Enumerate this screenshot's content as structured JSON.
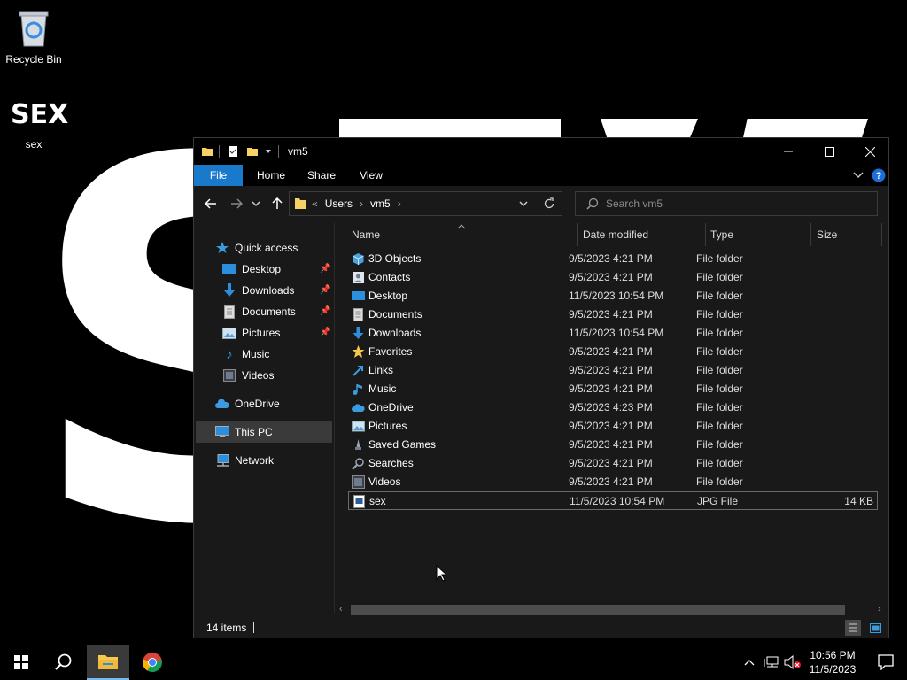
{
  "desktop": {
    "recycle_bin_label": "Recycle Bin",
    "sex_icon_text": "SEX",
    "sex_file_label": "sex",
    "wallpaper_letter": "S"
  },
  "window": {
    "title": "vm5",
    "ribbon_tabs": [
      "File",
      "Home",
      "Share",
      "View"
    ],
    "breadcrumb": [
      "Users",
      "vm5"
    ],
    "search_placeholder": "Search vm5"
  },
  "nav": {
    "quick_access": "Quick access",
    "pinned": [
      "Desktop",
      "Downloads",
      "Documents",
      "Pictures"
    ],
    "unpinned": [
      "Music",
      "Videos"
    ],
    "onedrive": "OneDrive",
    "this_pc": "This PC",
    "network": "Network"
  },
  "columns": {
    "name": "Name",
    "date": "Date modified",
    "type": "Type",
    "size": "Size"
  },
  "files": [
    {
      "name": "3D Objects",
      "date": "9/5/2023 4:21 PM",
      "type": "File folder",
      "size": "",
      "icon": "3d-objects-icon"
    },
    {
      "name": "Contacts",
      "date": "9/5/2023 4:21 PM",
      "type": "File folder",
      "size": "",
      "icon": "contacts-icon"
    },
    {
      "name": "Desktop",
      "date": "11/5/2023 10:54 PM",
      "type": "File folder",
      "size": "",
      "icon": "desktop-icon"
    },
    {
      "name": "Documents",
      "date": "9/5/2023 4:21 PM",
      "type": "File folder",
      "size": "",
      "icon": "documents-icon"
    },
    {
      "name": "Downloads",
      "date": "11/5/2023 10:54 PM",
      "type": "File folder",
      "size": "",
      "icon": "downloads-icon"
    },
    {
      "name": "Favorites",
      "date": "9/5/2023 4:21 PM",
      "type": "File folder",
      "size": "",
      "icon": "favorites-icon"
    },
    {
      "name": "Links",
      "date": "9/5/2023 4:21 PM",
      "type": "File folder",
      "size": "",
      "icon": "links-icon"
    },
    {
      "name": "Music",
      "date": "9/5/2023 4:21 PM",
      "type": "File folder",
      "size": "",
      "icon": "music-icon"
    },
    {
      "name": "OneDrive",
      "date": "9/5/2023 4:23 PM",
      "type": "File folder",
      "size": "",
      "icon": "onedrive-icon"
    },
    {
      "name": "Pictures",
      "date": "9/5/2023 4:21 PM",
      "type": "File folder",
      "size": "",
      "icon": "pictures-icon"
    },
    {
      "name": "Saved Games",
      "date": "9/5/2023 4:21 PM",
      "type": "File folder",
      "size": "",
      "icon": "saved-games-icon"
    },
    {
      "name": "Searches",
      "date": "9/5/2023 4:21 PM",
      "type": "File folder",
      "size": "",
      "icon": "searches-icon"
    },
    {
      "name": "Videos",
      "date": "9/5/2023 4:21 PM",
      "type": "File folder",
      "size": "",
      "icon": "videos-icon"
    },
    {
      "name": "sex",
      "date": "11/5/2023 10:54 PM",
      "type": "JPG File",
      "size": "14 KB",
      "icon": "jpg-file-icon"
    }
  ],
  "status": {
    "item_count": "14 items"
  },
  "taskbar": {
    "time": "10:56 PM",
    "date": "11/5/2023"
  },
  "colors": {
    "accent": "#1979ca",
    "window_bg": "#191919",
    "folder_yellow": "#f6d266",
    "help_blue": "#1e6ed8"
  }
}
